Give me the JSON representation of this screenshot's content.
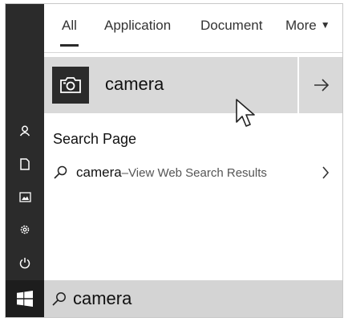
{
  "tabs": [
    {
      "label": "All",
      "active": true
    },
    {
      "label": "Application",
      "active": false
    },
    {
      "label": "Document",
      "active": false
    },
    {
      "label": "More",
      "active": false
    }
  ],
  "more_caret": "▼",
  "best_match": {
    "name": "camera",
    "icon": "camera-icon",
    "open_arrow": "→"
  },
  "section": {
    "title": "Search Page"
  },
  "web_result": {
    "query": "camera",
    "suffix": "–View Web Search Results",
    "chevron": ">"
  },
  "search_box": {
    "value": "camera"
  },
  "rail_icons": [
    "user-icon",
    "document-icon",
    "picture-icon",
    "settings-icon",
    "power-icon",
    "windows-logo-icon"
  ],
  "colors": {
    "rail": "#2b2b2b",
    "highlight": "#d9d9d9",
    "search_bar": "#d4d4d4"
  }
}
